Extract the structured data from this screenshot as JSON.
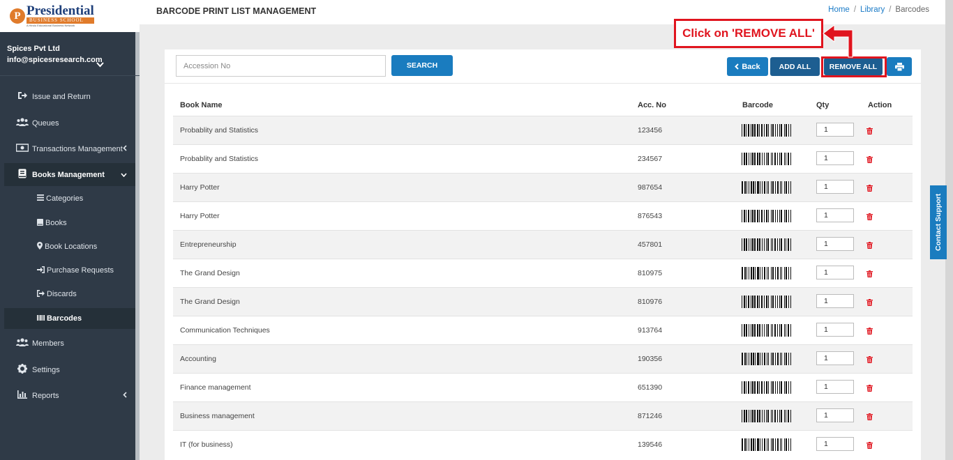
{
  "brand": {
    "logo_letter": "P",
    "logo_main": "Presidential",
    "logo_sub": "BUSINESS SCHOOL",
    "logo_tag": "A Hindu Educational Business Network"
  },
  "user": {
    "company": "Spices Pvt Ltd",
    "email": "info@spicesresearch.com"
  },
  "sidebar": {
    "items": [
      {
        "label": "Issue and Return",
        "icon": "sign-out-icon"
      },
      {
        "label": "Queues",
        "icon": "users-icon"
      },
      {
        "label": "Transactions Management",
        "icon": "money-icon"
      },
      {
        "label": "Books Management",
        "icon": "book-icon"
      },
      {
        "label": "Members",
        "icon": "users-icon"
      },
      {
        "label": "Settings",
        "icon": "gear-icon"
      },
      {
        "label": "Reports",
        "icon": "bar-chart-icon"
      }
    ],
    "sub_items": [
      {
        "label": "Categories",
        "icon": "list-icon"
      },
      {
        "label": "Books",
        "icon": "book-icon"
      },
      {
        "label": "Book Locations",
        "icon": "map-marker-icon"
      },
      {
        "label": "Purchase Requests",
        "icon": "sign-in-icon"
      },
      {
        "label": "Discards",
        "icon": "sign-out-icon"
      },
      {
        "label": "Barcodes",
        "icon": "barcode-icon"
      }
    ]
  },
  "header": {
    "title": "BARCODE PRINT LIST MANAGEMENT",
    "breadcrumb": [
      "Home",
      "Library",
      "Barcodes"
    ]
  },
  "toolbar": {
    "search_placeholder": "Accession No",
    "search_label": "SEARCH",
    "back_label": "Back",
    "add_all_label": "ADD ALL",
    "remove_all_label": "REMOVE ALL"
  },
  "annotation": {
    "text": "Click on 'REMOVE ALL'",
    "color": "#e0141e"
  },
  "table": {
    "columns": [
      "Book Name",
      "Acc. No",
      "Barcode",
      "Qty",
      "Action"
    ],
    "rows": [
      {
        "book": "Probablity and Statistics",
        "acc": "123456",
        "qty": "1"
      },
      {
        "book": "Probablity and Statistics",
        "acc": "234567",
        "qty": "1"
      },
      {
        "book": "Harry Potter",
        "acc": "987654",
        "qty": "1"
      },
      {
        "book": "Harry Potter",
        "acc": "876543",
        "qty": "1"
      },
      {
        "book": "Entrepreneurship",
        "acc": "457801",
        "qty": "1"
      },
      {
        "book": "The Grand Design",
        "acc": "810975",
        "qty": "1"
      },
      {
        "book": "The Grand Design",
        "acc": "810976",
        "qty": "1"
      },
      {
        "book": "Communication Techniques",
        "acc": "913764",
        "qty": "1"
      },
      {
        "book": "Accounting",
        "acc": "190356",
        "qty": "1"
      },
      {
        "book": "Finance management",
        "acc": "651390",
        "qty": "1"
      },
      {
        "book": "Business management",
        "acc": "871246",
        "qty": "1"
      },
      {
        "book": "IT (for business)",
        "acc": "139546",
        "qty": "1"
      }
    ]
  },
  "contact_support": "Contact Support",
  "colors": {
    "sidebar_bg": "#2f3a47",
    "primary": "#1a7cbf",
    "primary_dark": "#1d5e91",
    "danger": "#e0141e"
  }
}
